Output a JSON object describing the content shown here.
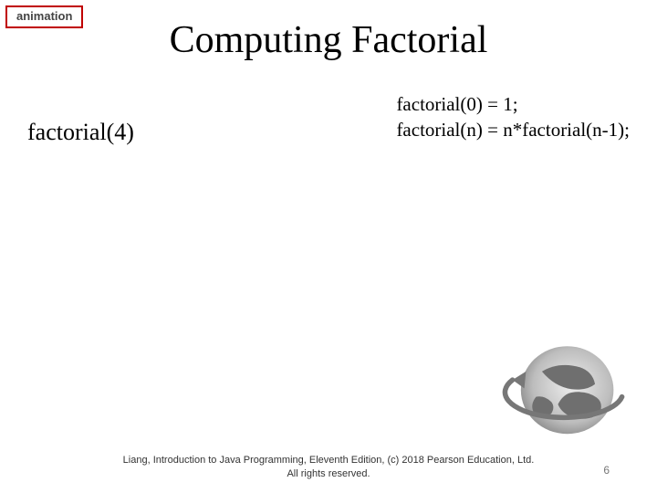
{
  "tag": "animation",
  "title": "Computing Factorial",
  "step": "factorial(4)",
  "rules": {
    "line1": "factorial(0) = 1;",
    "line2": "factorial(n) = n*factorial(n-1);"
  },
  "footer": {
    "line1": "Liang, Introduction to Java Programming, Eleventh Edition, (c) 2018 Pearson Education, Ltd.",
    "line2": "All rights reserved."
  },
  "page_number": "6"
}
